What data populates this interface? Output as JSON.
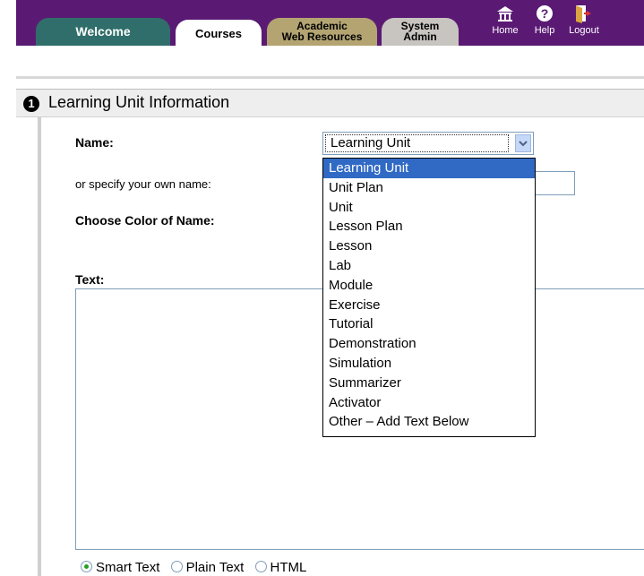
{
  "tabs": {
    "welcome": "Welcome",
    "courses": "Courses",
    "academic_line1": "Academic",
    "academic_line2": "Web Resources",
    "system_line1": "System",
    "system_line2": "Admin"
  },
  "top_nav": {
    "home": "Home",
    "help": "Help",
    "logout": "Logout"
  },
  "section": {
    "number": "1",
    "title": "Learning Unit Information"
  },
  "form": {
    "name_label": "Name:",
    "own_name_label": "or specify your own name:",
    "color_label": "Choose Color of Name:",
    "text_label": "Text:",
    "name_selected": "Learning Unit",
    "name_options": [
      "Learning Unit",
      "Unit Plan",
      "Unit",
      "Lesson Plan",
      "Lesson",
      "Lab",
      "Module",
      "Exercise",
      "Tutorial",
      "Demonstration",
      "Simulation",
      "Summarizer",
      "Activator",
      "Other – Add Text Below"
    ],
    "text_formats": [
      "Smart Text",
      "Plain Text",
      "HTML"
    ],
    "text_format_selected": "Smart Text"
  },
  "colors": {
    "header_band": "#5a1a74",
    "welcome_tab": "#2f6e6a",
    "academic_tab": "#b3a472",
    "system_tab": "#c8c4c0",
    "highlight": "#316ac5"
  },
  "icons": [
    "home-icon",
    "help-icon",
    "logout-icon",
    "chevron-down-icon"
  ]
}
